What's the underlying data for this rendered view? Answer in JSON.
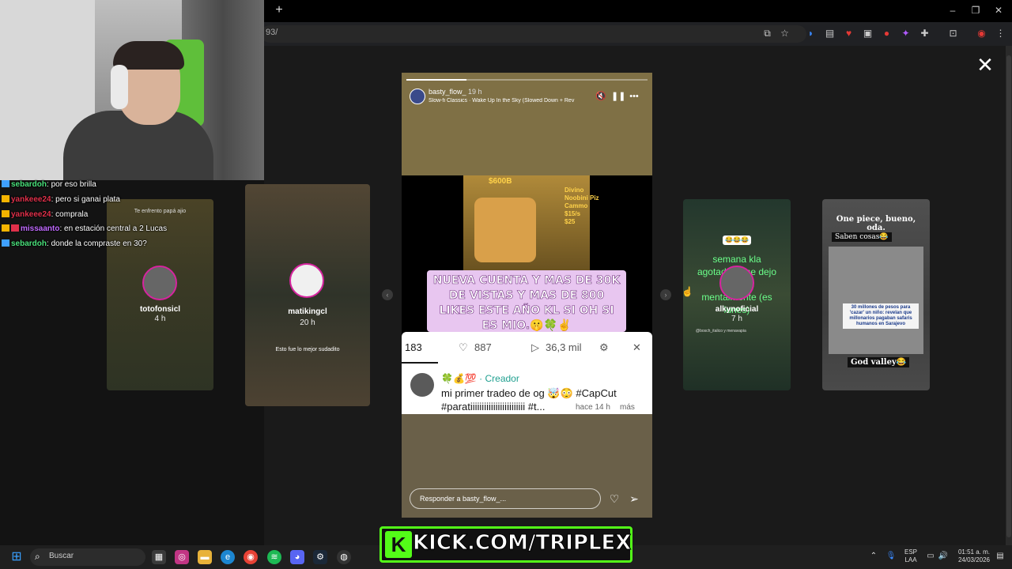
{
  "browser": {
    "new_tab": "+",
    "url": "93/",
    "win_minimize": "–",
    "win_maximize": "❐",
    "win_close": "✕"
  },
  "viewer": {
    "close": "✕",
    "prev_arrow": "‹",
    "next_arrow": "›"
  },
  "stories": [
    {
      "user": "totofonsicl",
      "time": "4 h",
      "overlay": "Te enfrento papá ajio"
    },
    {
      "user": "matikingcl",
      "time": "20 h",
      "overlay": "Esto fue lo mejor sudadito"
    },
    {
      "user": "basty_flow_",
      "time": "19 h"
    },
    {
      "user": "alkynoficial",
      "time": "7 h",
      "overlay": "semana kla agotadora me dejo la plaga mentalmente (es lunes)",
      "badge": "😂😂😂",
      "footer": "@bosch_italico y menavapia"
    },
    {
      "user": "",
      "time": "",
      "top_text": "One piece, bueno, oda.",
      "sub_text": "Saben cosas😂",
      "headline": "30 millones de pesos para 'cazar' un niño: revelan que millonarios pagaban safaris humanos en Sarajevo",
      "bottom_text": "God valley😂"
    }
  ],
  "main_story": {
    "user": "basty_flow_",
    "time": "19 h",
    "music": "Slow-fi Classics · Wake Up In the Sky (Slowed Down + Rev",
    "reply_placeholder": "Responder a basty_flow_...",
    "progress": 0.25,
    "tiktok": {
      "price_top": "$600B",
      "price_side": "Divino\nNoobini Piz\nCammo\n$15/s\n$25",
      "caption": "NUEVA CUENTA Y MAS DE 30K DE VISTAS Y MAS DE 800 LIKES ESTE AÑO KL SI OH SI ES MIO.🤫🍀✌️",
      "comments": "183",
      "likes": "887",
      "plays": "36,3 mil",
      "creator_label": "🍀💰💯 · Creador",
      "description": "mi primer tradeo de og 🤯😳 #CapCut #paratiiiiiiiiiiiiiiiiiiiiiiii #t...",
      "time_ago": "hace 14 h",
      "more": "más"
    }
  },
  "chat": [
    {
      "user": "sebardoh",
      "text": "por eso brilla",
      "color": "#49e07a"
    },
    {
      "user": "yankeee24",
      "text": "pero si ganai plata",
      "color": "#e0304a"
    },
    {
      "user": "yankeee24",
      "text": "comprala",
      "color": "#e0304a"
    },
    {
      "user": "missaanto",
      "text": "en estación central a 2 Lucas",
      "color": "#c06aff"
    },
    {
      "user": "sebardoh",
      "text": "donde la compraste en 30?",
      "color": "#49e07a"
    }
  ],
  "taskbar": {
    "search_placeholder": "Buscar",
    "kick_logo": "K",
    "kick_text": "KICK.COM/TRIPLEX",
    "lang_line1": "ESP",
    "lang_line2": "LAA",
    "time": "01:51 a. m.",
    "date": "24/03/2026"
  },
  "colors": {
    "kick_green": "#53fc18",
    "tiktok_creator": "#20a090",
    "story_ring": "#d6249f"
  }
}
